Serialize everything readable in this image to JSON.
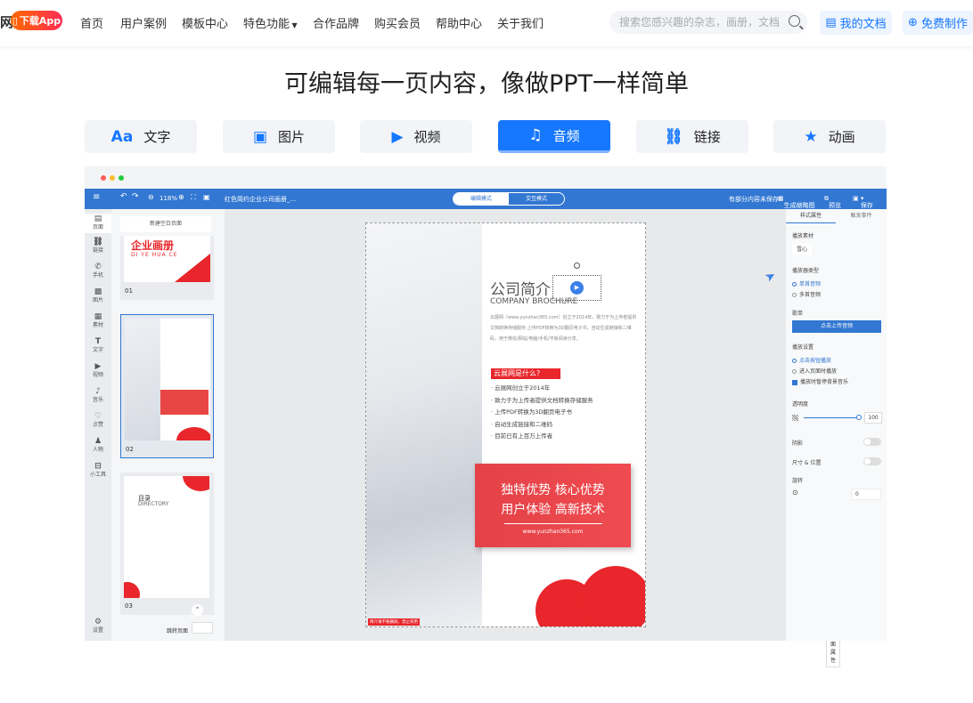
{
  "header": {
    "logo_fragment": "网",
    "download_app": "下载App",
    "nav": [
      "首页",
      "用户案例",
      "模板中心",
      "特色功能",
      "合作品牌",
      "购买会员",
      "帮助中心",
      "关于我们"
    ],
    "search_placeholder": "搜索您感兴趣的杂志，画册，文档",
    "my_docs": "我的文档",
    "free_make": "免费制作"
  },
  "headline": "可编辑每一页内容，像做PPT一样简单",
  "feature_tabs": [
    {
      "label": "文字",
      "icon": "text-icon"
    },
    {
      "label": "图片",
      "icon": "image-icon"
    },
    {
      "label": "视频",
      "icon": "video-icon"
    },
    {
      "label": "音频",
      "icon": "music-icon",
      "active": true
    },
    {
      "label": "链接",
      "icon": "link-icon"
    },
    {
      "label": "动画",
      "icon": "star-icon"
    }
  ],
  "editor": {
    "toolbar": {
      "zoom": "118%",
      "doc_title": "红色简约企业公司画册_...",
      "mode_edit": "编辑模式",
      "mode_interact": "交互模式",
      "status": "有部分内容未保存!",
      "thumb_gen": "生成缩略图",
      "preview": "预览",
      "save": "保存"
    },
    "rail": [
      "页面",
      "链接",
      "手机",
      "图片",
      "素材",
      "文字",
      "视频",
      "音乐",
      "点赞",
      "人物",
      "小工具",
      "设置"
    ],
    "thumbs": {
      "new_page": "新建空白页面",
      "pages": [
        "01",
        "02",
        "03"
      ],
      "page1_title": "企业画册",
      "page1_sub": "DI YE HUA CE",
      "page3_title": "目录",
      "page3_sub": "DIRECTORY",
      "jump_label": "跳转页面"
    },
    "page": {
      "title": "公司简介",
      "subtitle": "COMPANY BROCHURE",
      "intro": "云展网（www.yunzhan365.com）创立于2014年，致力于为上传者提供文档转换存储服务-上传PDF转换为3D翻页电子书，自动生成链接和二维码，用于微信/网站/电脑/手机/平板阅读分享。",
      "question": "云展网是什么?",
      "bullets": [
        "· 云展网创立于2014年",
        "· 致力于为上传者提供文档转换存储服务",
        "· 上传PDF转换为3D翻页电子书",
        "· 自动生成链接和二维码",
        "· 目前已有上百万上传者"
      ],
      "banner_line1": "独特优势  核心优势",
      "banner_line2": "用户体验  高新技术",
      "banner_url": "www.yunzhan365.com",
      "footer_note": "简介请不要删除，禁止商用",
      "corner_btn": "打开页面属性"
    },
    "panel": {
      "tabs": [
        "样式属性",
        "触发事件"
      ],
      "audio_material": "播放素材",
      "material_value": "雪心",
      "player_type": "播放器类型",
      "single": "单首音频",
      "multi": "多首音频",
      "playlist": "歌单",
      "upload": "点击上传音频",
      "play_settings": "播放设置",
      "click_play": "点击按钮播放",
      "auto_play": "进入页面时播放",
      "stop_on_leave": "播放时暂停背景音乐",
      "opacity": "透明度",
      "opacity_value": "100",
      "shadow": "阴影",
      "size_pos": "尺寸 & 位置",
      "rotate": "旋转",
      "rotate_value": "0"
    }
  },
  "colors": {
    "accent": "#1677ff",
    "toolbar": "#3277d2",
    "red": "#e8262b"
  }
}
